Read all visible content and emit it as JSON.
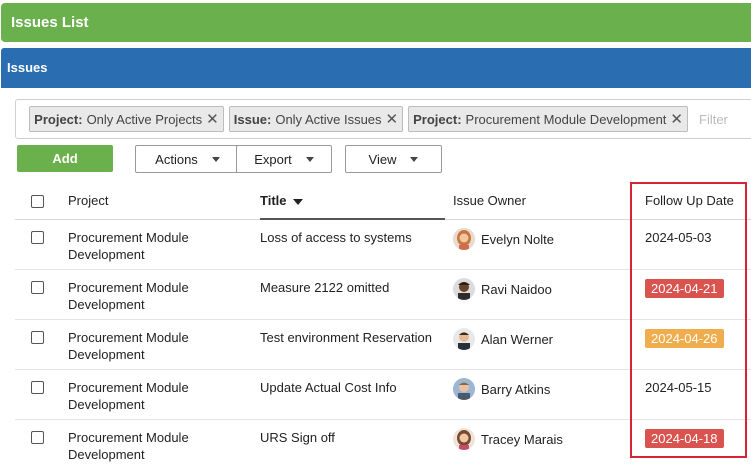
{
  "window": {
    "title": "Issues List"
  },
  "panel": {
    "title": "Issues"
  },
  "filters": {
    "chips": [
      {
        "key": "Project:",
        "value": "Only Active Projects"
      },
      {
        "key": "Issue:",
        "value": "Only Active Issues"
      },
      {
        "key": "Project:",
        "value": "Procurement Module Development"
      }
    ],
    "placeholder": "Filter"
  },
  "toolbar": {
    "add": "Add",
    "actions": "Actions",
    "export": "Export",
    "view": "View"
  },
  "table": {
    "columns": {
      "project": "Project",
      "title": "Title",
      "owner": "Issue Owner",
      "follow_up": "Follow Up Date"
    },
    "rows": [
      {
        "project_l1": "Procurement Module",
        "project_l2": "Development",
        "title": "Loss of access to systems",
        "owner": "Evelyn Nolte",
        "date": "2024-05-03",
        "status": "normal"
      },
      {
        "project_l1": "Procurement Module",
        "project_l2": "Development",
        "title": "Measure 2122 omitted",
        "owner": "Ravi Naidoo",
        "date": "2024-04-21",
        "status": "overdue"
      },
      {
        "project_l1": "Procurement Module",
        "project_l2": "Development",
        "title": "Test environment Reservation",
        "owner": "Alan Werner",
        "date": "2024-04-26",
        "status": "due-soon"
      },
      {
        "project_l1": "Procurement Module",
        "project_l2": "Development",
        "title": "Update Actual Cost Info",
        "owner": "Barry Atkins",
        "date": "2024-05-15",
        "status": "normal"
      },
      {
        "project_l1": "Procurement Module",
        "project_l2": "Development",
        "title": "URS Sign off",
        "owner": "Tracey Marais",
        "date": "2024-04-18",
        "status": "overdue"
      }
    ]
  },
  "colors": {
    "green": "#6ab04c",
    "blue": "#2a6db1",
    "overdue": "#d9534f",
    "due_soon": "#f0ad4e",
    "highlight": "#d9232e"
  }
}
